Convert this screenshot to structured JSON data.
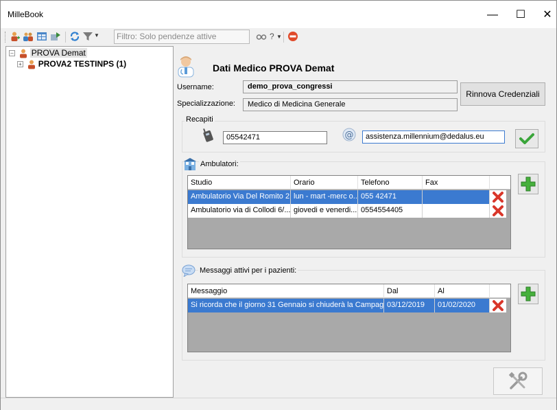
{
  "window": {
    "title": "MilleBook"
  },
  "toolbar": {
    "filter_text": "Filtro: Solo pendenze attive",
    "help_label": "?"
  },
  "tree": [
    {
      "label": "PROVA Demat",
      "bold": false
    },
    {
      "label": "PROVA2 TESTINPS (1)",
      "bold": true
    }
  ],
  "doctor": {
    "heading": "Dati Medico  PROVA Demat",
    "username_label": "Username:",
    "username": "demo_prova_congressi",
    "specialization_label": "Specializzazione:",
    "specialization": "Medico di Medicina Generale",
    "renew_button": "Rinnova Credenziali"
  },
  "contacts": {
    "legend": "Recapiti",
    "phone": "05542471",
    "email": "assistenza.millennium@dedalus.eu"
  },
  "ambulatori": {
    "label": "Ambulatori:",
    "columns": [
      "Studio",
      "Orario",
      "Telefono",
      "Fax"
    ],
    "rows": [
      {
        "studio": "Ambulatorio Via Del Romito 2",
        "orario": "lun - mart -merc o...",
        "telefono": "055 42471",
        "fax": "",
        "selected": true
      },
      {
        "studio": "Ambulatorio via di Collodi 6/...",
        "orario": "giovedi e venerdi...",
        "telefono": "0554554405",
        "fax": "",
        "selected": false
      }
    ]
  },
  "messaggi": {
    "label": "Messaggi attivi per i pazienti:",
    "columns": [
      "Messaggio",
      "Dal",
      "Al"
    ],
    "rows": [
      {
        "messaggio": "Si ricorda che il giorno 31 Gennaio si chiuderà la Campag...",
        "dal": "03/12/2019",
        "al": "01/02/2020",
        "selected": true
      }
    ]
  },
  "colors": {
    "selection": "#3b7ad0",
    "grid_bg": "#a9a9a9",
    "ok_green": "#3aa53a",
    "delete_red": "#d9362a",
    "plus_green": "#46b03c"
  }
}
